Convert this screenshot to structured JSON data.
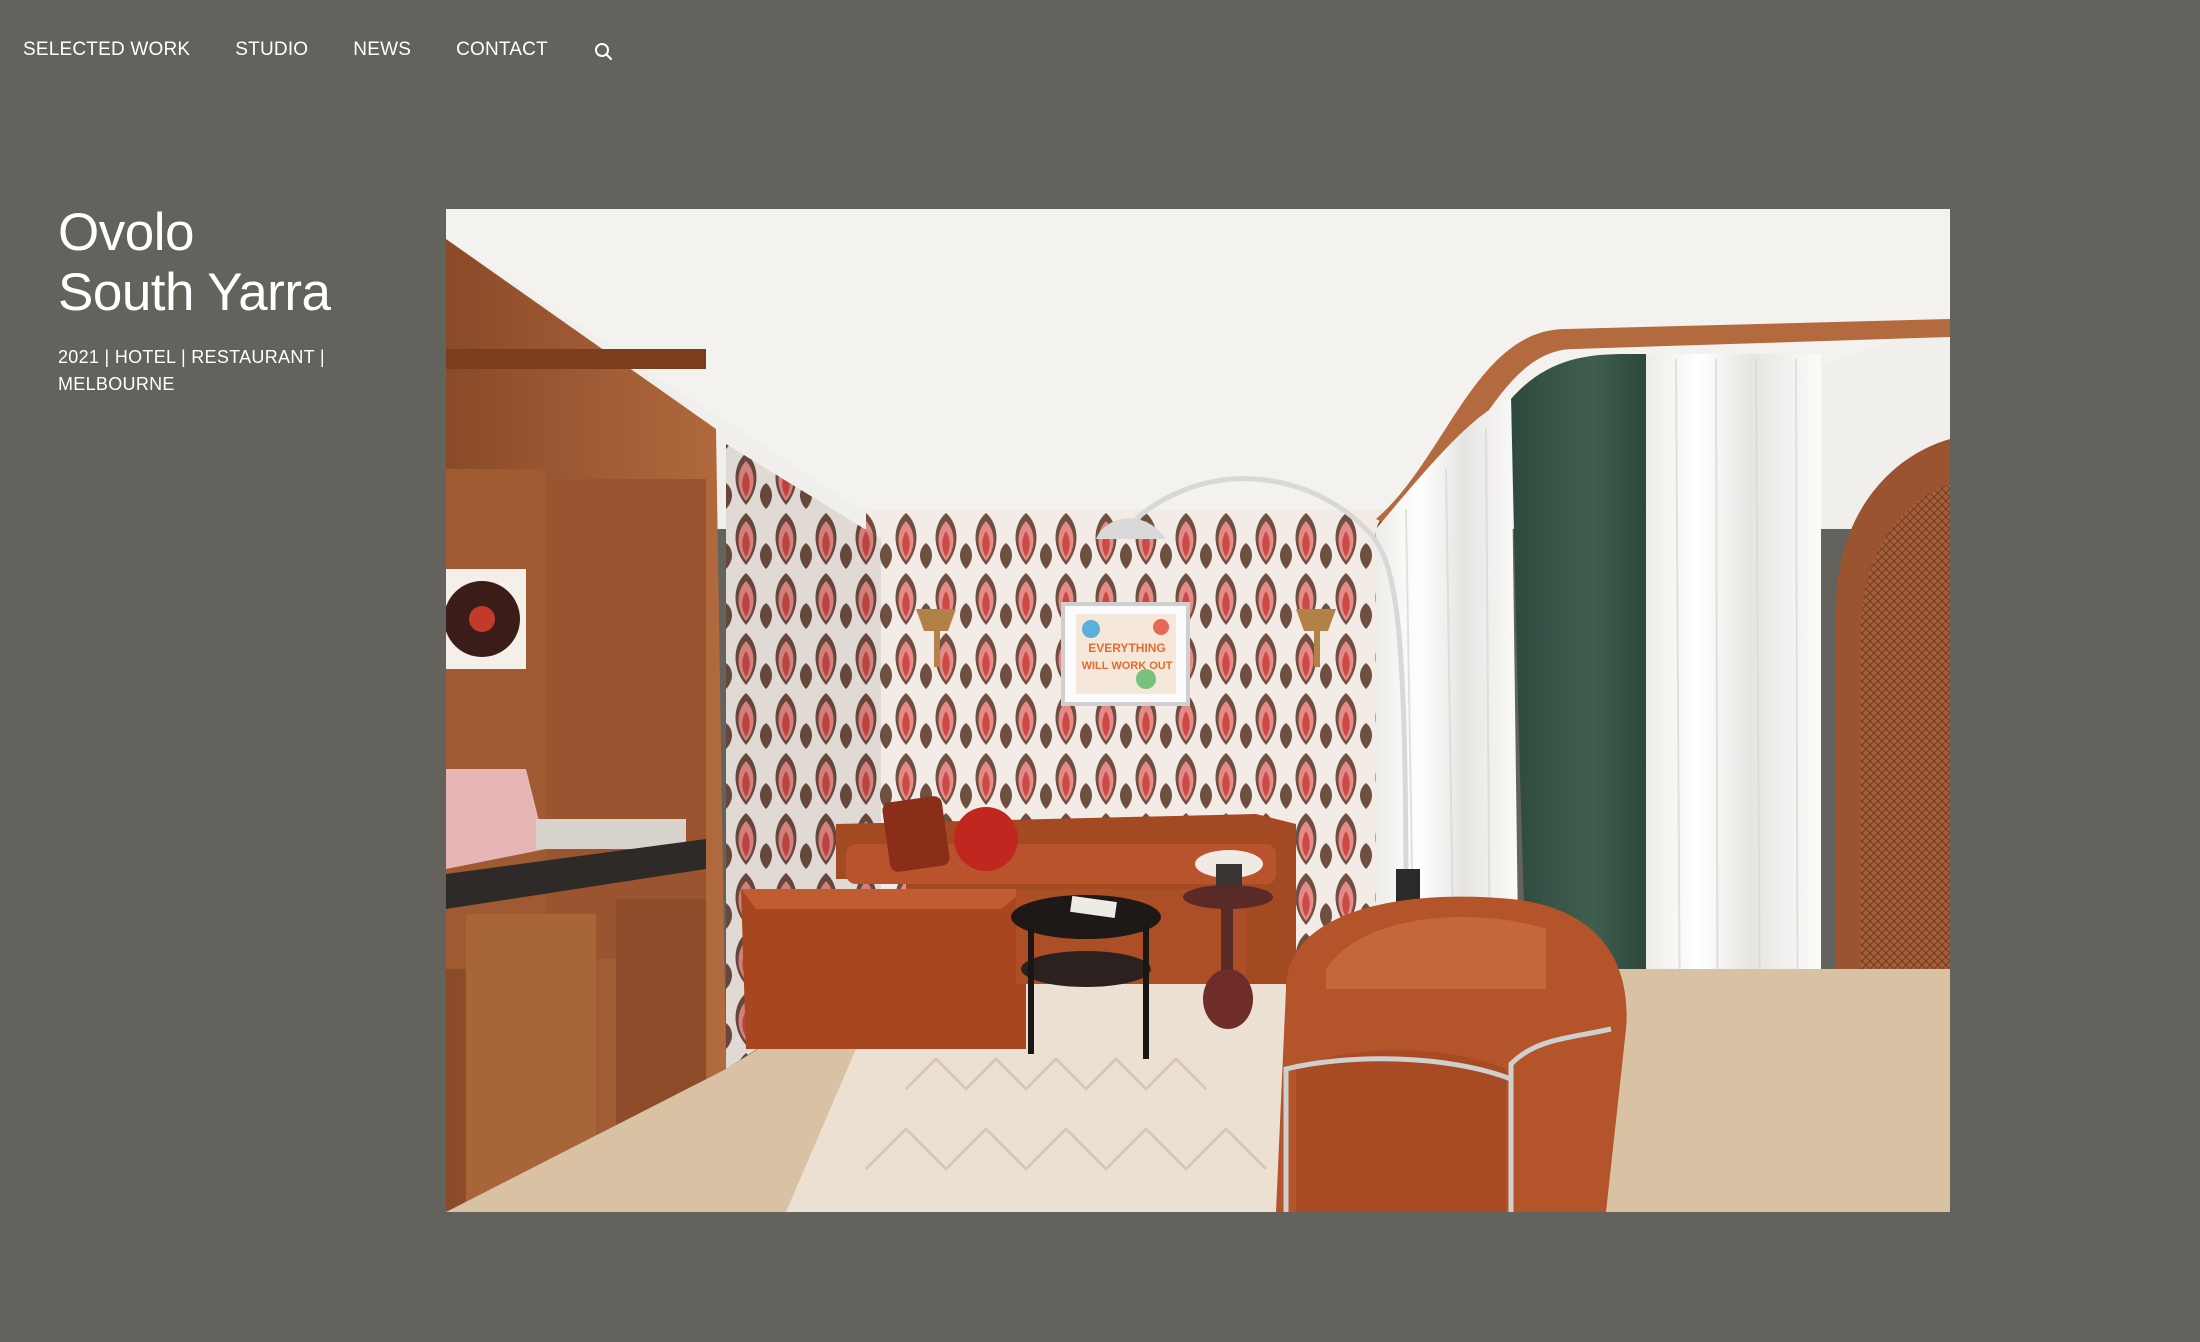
{
  "nav": {
    "items": [
      {
        "label": "SELECTED WORK"
      },
      {
        "label": "STUDIO"
      },
      {
        "label": "NEWS"
      },
      {
        "label": "CONTACT"
      }
    ],
    "search_icon": "search-icon"
  },
  "project": {
    "title_line1": "Ovolo",
    "title_line2": "South Yarra",
    "meta_line1": "2021 | HOTEL  | RESTAURANT |",
    "meta_line2": "MELBOURNE"
  },
  "hero_image": {
    "subject": "hotel-lounge-photo",
    "artwork_text_line1": "EVERYTHING",
    "artwork_text_line2": "WILL WORK OUT"
  },
  "colors": {
    "background": "#63625c",
    "text": "#ffffff",
    "accent_orange": "#b8532b",
    "accent_green": "#3e5a4c",
    "wallpaper_pink": "#e07d7a"
  }
}
